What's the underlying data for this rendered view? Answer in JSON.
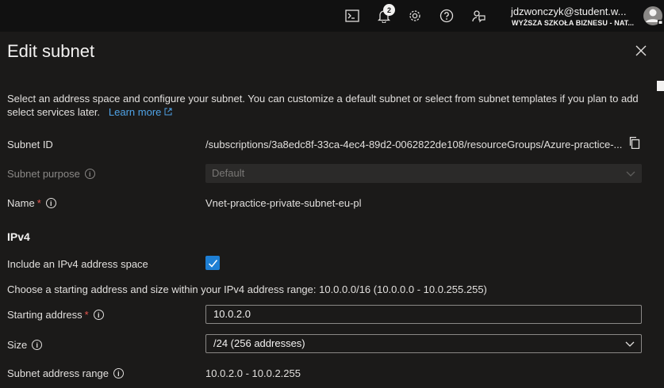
{
  "topbar": {
    "icons": [
      "cloud-shell-icon",
      "notifications-icon",
      "settings-icon",
      "help-icon",
      "feedback-icon"
    ],
    "notification_count": "2",
    "user_email": "jdzwonczyk@student.w...",
    "user_org": "WYŻSZA SZKOŁA BIZNESU - NAT..."
  },
  "panel": {
    "title": "Edit subnet",
    "description": "Select an address space and configure your subnet. You can customize a default subnet or select from subnet templates if you plan to add select services later.",
    "learn_more": "Learn more"
  },
  "form": {
    "subnet_id_label": "Subnet ID",
    "subnet_id_value": "/subscriptions/3a8edc8f-33ca-4ec4-89d2-0062822de108/resourceGroups/Azure-practice-...",
    "subnet_purpose_label": "Subnet purpose",
    "subnet_purpose_value": "Default",
    "name_label": "Name",
    "name_value": "Vnet-practice-private-subnet-eu-pl",
    "required_mark": "*",
    "ipv4_section": "IPv4",
    "include_ipv4_label": "Include an IPv4 address space",
    "include_ipv4_checked": true,
    "range_hint": "Choose a starting address and size within your IPv4 address range: 10.0.0.0/16 (10.0.0.0 - 10.0.255.255)",
    "starting_address_label": "Starting address",
    "starting_address_value": "10.0.2.0",
    "size_label": "Size",
    "size_value": "/24 (256 addresses)",
    "subnet_range_label": "Subnet address range",
    "subnet_range_value": "10.0.2.0 - 10.0.2.255"
  },
  "colors": {
    "accent": "#1e7fd4",
    "link": "#4fa3e6",
    "required": "#e8574f",
    "background": "#1b1a19"
  }
}
